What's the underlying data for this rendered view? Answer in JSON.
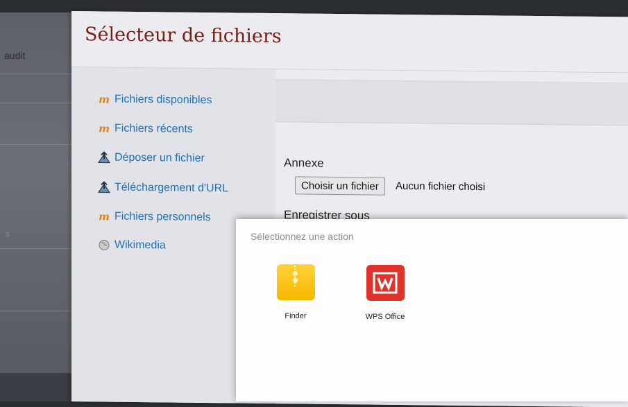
{
  "background": {
    "left_label": "audit",
    "hint": "s"
  },
  "picker": {
    "title": "Sélecteur de fichiers",
    "repositories": [
      {
        "label": "Fichiers disponibles",
        "icon": "moodle-icon"
      },
      {
        "label": "Fichiers récents",
        "icon": "moodle-icon"
      },
      {
        "label": "Déposer un fichier",
        "icon": "upload-icon"
      },
      {
        "label": "Téléchargement d'URL",
        "icon": "upload-icon"
      },
      {
        "label": "Fichiers personnels",
        "icon": "moodle-icon"
      },
      {
        "label": "Wikimedia",
        "icon": "globe-icon"
      }
    ],
    "form": {
      "attachment_label": "Annexe",
      "choose_button": "Choisir un fichier",
      "no_file": "Aucun fichier choisi",
      "save_as_label": "Enregistrer sous"
    }
  },
  "chooser": {
    "title": "Sélectionnez une action",
    "apps": [
      {
        "label": "Finder",
        "icon": "finder-icon",
        "color": "#f6b800"
      },
      {
        "label": "WPS Office",
        "icon": "wps-office-icon",
        "color": "#e0332c"
      }
    ]
  },
  "colors": {
    "title": "#7a1d14",
    "link": "#1d6fb6",
    "moodle_orange": "#e2801b"
  }
}
